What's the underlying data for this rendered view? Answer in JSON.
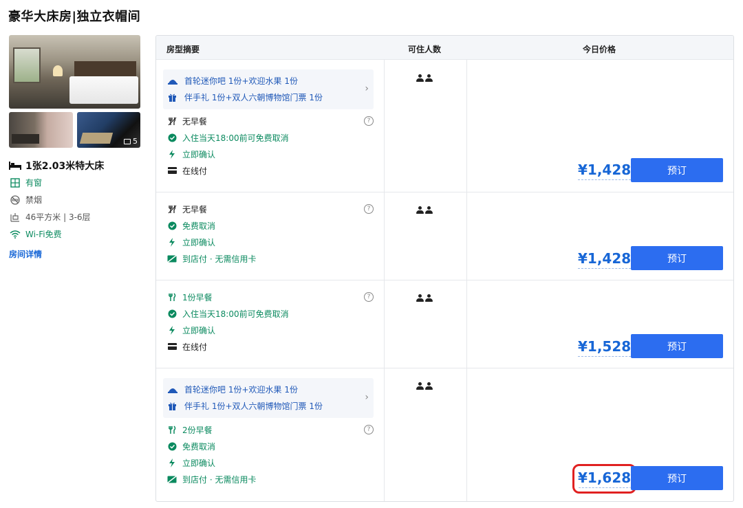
{
  "room_title": "豪华大床房|独立衣帽间",
  "photo_count": "5",
  "room_facts": {
    "bed": "1张2.03米特大床",
    "window": "有窗",
    "smoking": "禁烟",
    "size_floor": "46平方米 | 3-6层",
    "wifi": "Wi-Fi免费"
  },
  "room_detail_link": "房间详情",
  "table_headers": {
    "summary": "房型摘要",
    "occupancy": "可住人数",
    "price": "今日价格"
  },
  "rates": [
    {
      "gifts": [
        "首轮迷你吧 1份+欢迎水果 1份",
        "伴手礼 1份+双人六朝博物馆门票 1份"
      ],
      "breakfast": "无早餐",
      "cancel": "入住当天18:00前可免费取消",
      "confirm": "立即确认",
      "payment": "在线付",
      "price": "¥1,428",
      "book": "预订"
    },
    {
      "breakfast": "无早餐",
      "cancel": "免费取消",
      "confirm": "立即确认",
      "payment": "到店付 · 无需信用卡",
      "price": "¥1,428",
      "book": "预订"
    },
    {
      "breakfast": "1份早餐",
      "cancel": "入住当天18:00前可免费取消",
      "confirm": "立即确认",
      "payment": "在线付",
      "price": "¥1,528",
      "book": "预订"
    },
    {
      "gifts": [
        "首轮迷你吧 1份+欢迎水果 1份",
        "伴手礼 1份+双人六朝博物馆门票 1份"
      ],
      "breakfast": "2份早餐",
      "cancel": "免费取消",
      "confirm": "立即确认",
      "payment": "到店付 · 无需信用卡",
      "price": "¥1,628",
      "book": "预订"
    }
  ],
  "colors": {
    "accent": "#2c6df0",
    "price": "#1766d6",
    "green": "#0b8a5f",
    "highlight": "#e02020"
  }
}
